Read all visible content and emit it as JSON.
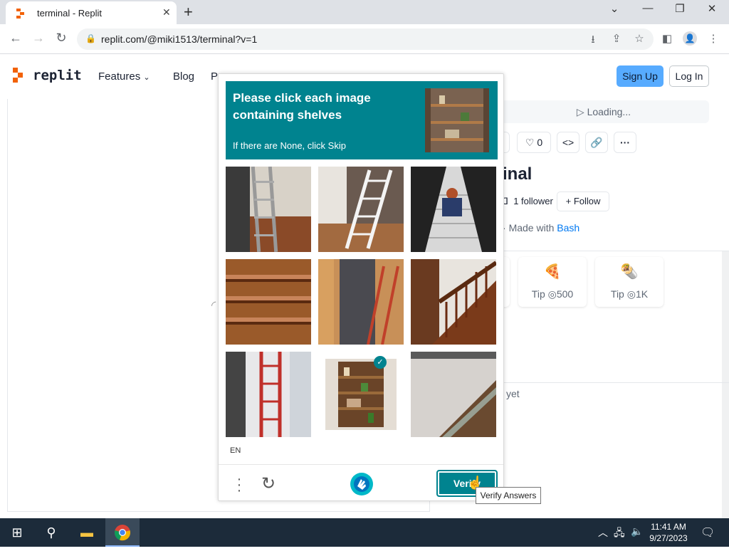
{
  "browser": {
    "tab_title": "terminal - Replit",
    "url": "replit.com/@miki1513/terminal?v=1"
  },
  "replit": {
    "logo_text": "replit",
    "nav": [
      "Features",
      "Blog",
      "P"
    ],
    "signup": "Sign Up",
    "login": "Log In",
    "loading": "Loading...",
    "likes": "0",
    "title_fragment": "inal",
    "follower": "1 follower",
    "follow": "Follow",
    "made_with_prefix": "Made with",
    "made_with_lang": "Bash",
    "tips": [
      {
        "icon": "pizza-icon",
        "emoji": "🍕",
        "label": "Tip",
        "amount": "500"
      },
      {
        "icon": "burrito-icon",
        "emoji": "🌯",
        "label": "Tip",
        "amount": "1K"
      }
    ],
    "yet_text": "yet"
  },
  "captcha": {
    "prompt": "Please click each image containing shelves",
    "subprompt": "If there are None, click Skip",
    "language": "EN",
    "verify_label": "Verify",
    "tooltip": "Verify Answers",
    "cells": [
      {
        "subject": "ladder by window",
        "selected": false
      },
      {
        "subject": "white ladder",
        "selected": false
      },
      {
        "subject": "escalator with person",
        "selected": false
      },
      {
        "subject": "wooden shelves",
        "selected": false
      },
      {
        "subject": "red ladder in hallway",
        "selected": false
      },
      {
        "subject": "wooden staircase",
        "selected": false
      },
      {
        "subject": "red ladder by window",
        "selected": false
      },
      {
        "subject": "bookshelf",
        "selected": true
      },
      {
        "subject": "glass staircase",
        "selected": false
      }
    ]
  },
  "taskbar": {
    "time": "11:41 AM",
    "date": "9/27/2023"
  },
  "colors": {
    "captcha_teal": "#00838f",
    "replit_orange": "#f26207",
    "signup_blue": "#57abff",
    "taskbar": "#1c2b3a"
  }
}
